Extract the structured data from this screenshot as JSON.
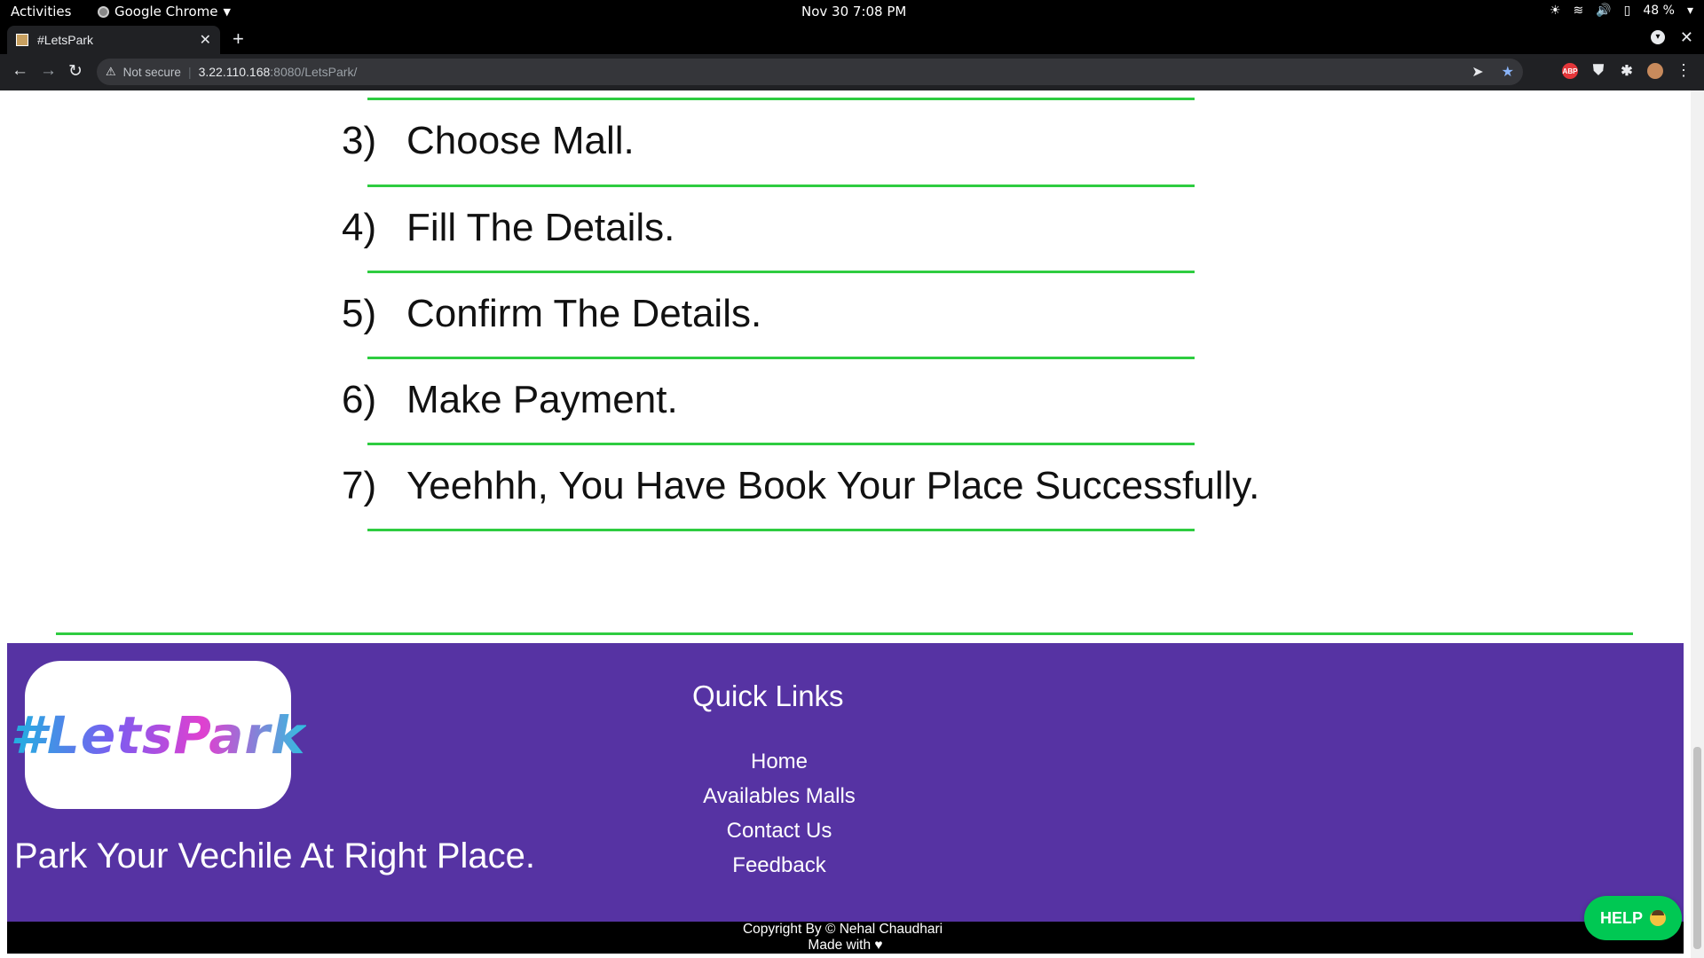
{
  "system_bar": {
    "activities": "Activities",
    "app_name": "Google Chrome",
    "clock": "Nov 30  7:08 PM",
    "battery": "48 %"
  },
  "browser": {
    "tab_title": "#LetsPark",
    "security_label": "Not secure",
    "url_host": "3.22.110.168",
    "url_path": ":8080/LetsPark/"
  },
  "steps": [
    {
      "num": "3)",
      "text": "Choose Mall."
    },
    {
      "num": "4)",
      "text": "Fill The Details."
    },
    {
      "num": "5)",
      "text": "Confirm The Details."
    },
    {
      "num": "6)",
      "text": "Make Payment."
    },
    {
      "num": "7)",
      "text": "Yeehhh, You Have Book Your Place Successfully."
    }
  ],
  "footer": {
    "logo_text": "#LetsPark",
    "tagline": "Park Your Vechile At Right Place.",
    "quick_links_title": "Quick Links",
    "links": [
      "Home",
      "Availables Malls",
      "Contact Us",
      "Feedback"
    ],
    "copyright": "Copyright By © Nehal Chaudhari",
    "made_with": "Made with ♥"
  },
  "help_button": "HELP",
  "colors": {
    "accent_green": "#2ecc40",
    "footer_purple": "#5633a3",
    "help_green": "#00c853"
  }
}
